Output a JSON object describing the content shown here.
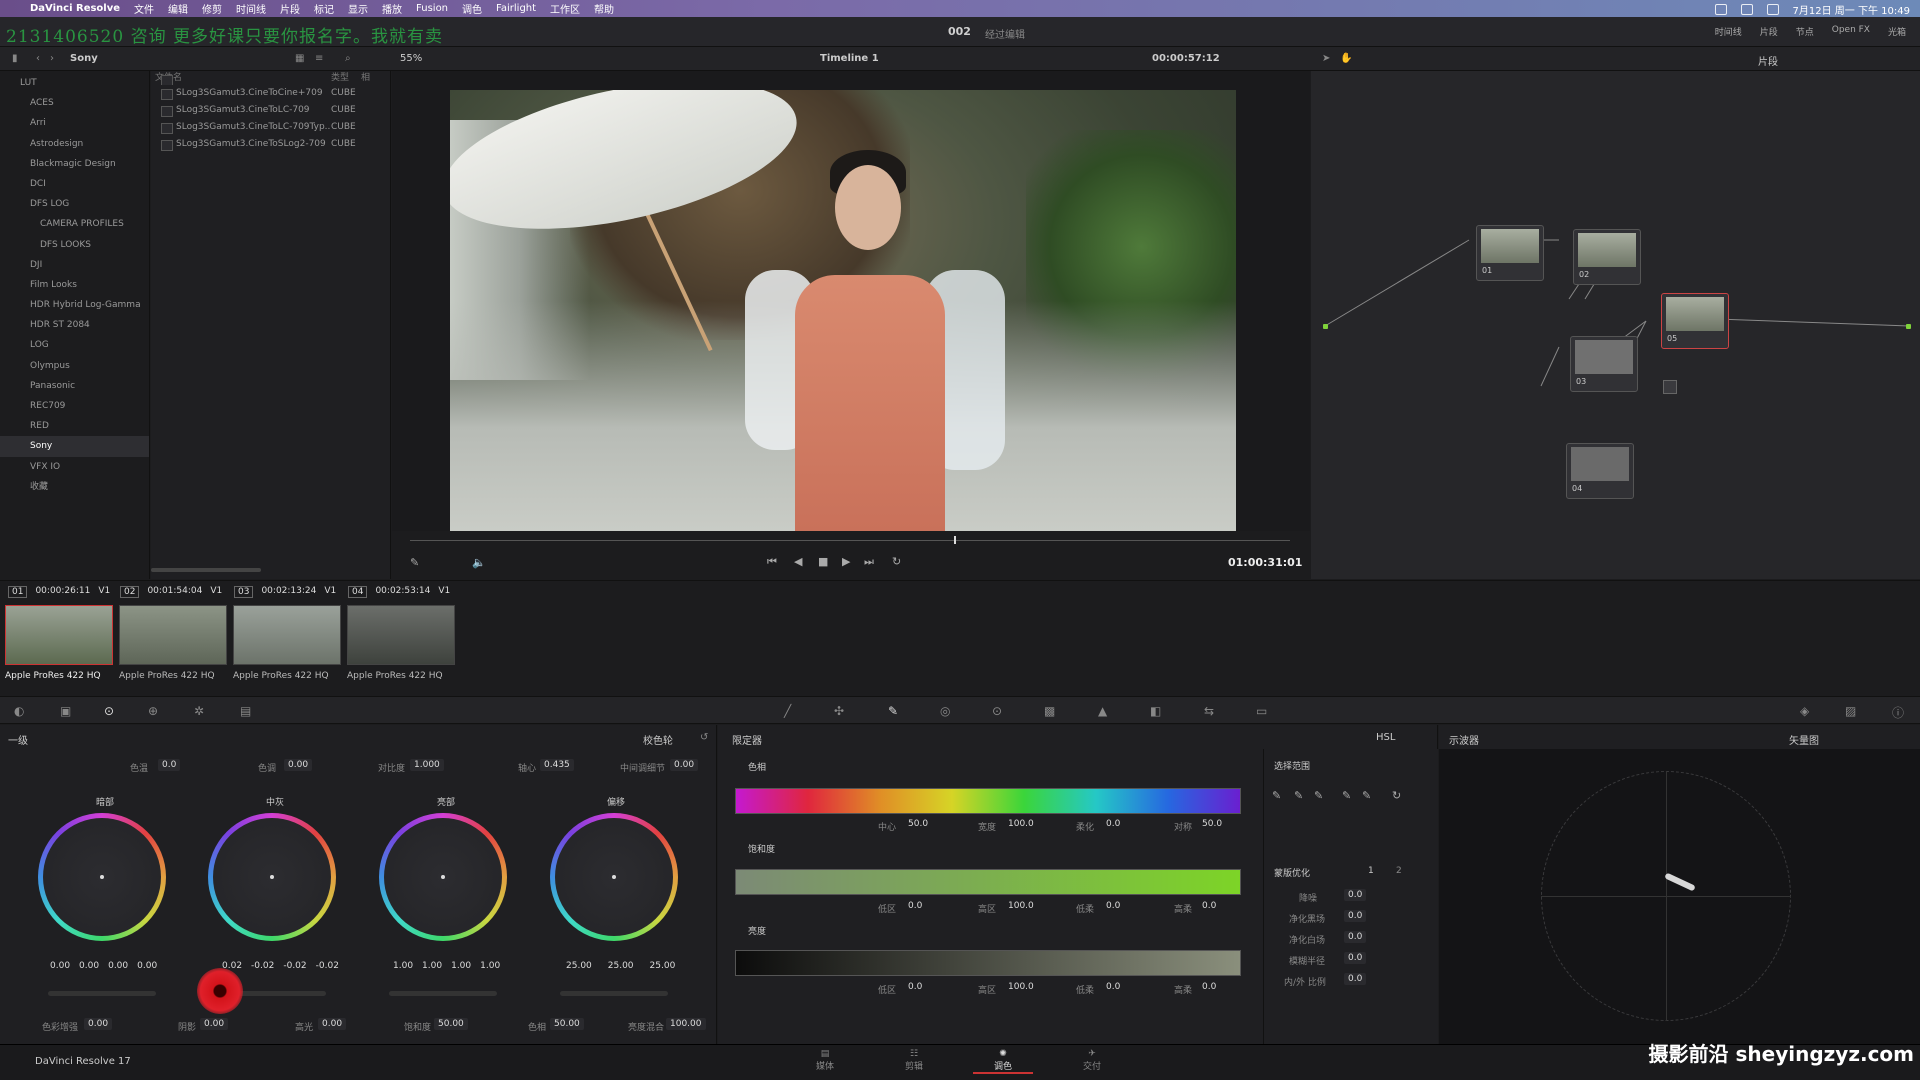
{
  "menubar": {
    "app": "DaVinci Resolve",
    "items": [
      "文件",
      "编辑",
      "修剪",
      "时间线",
      "片段",
      "标记",
      "显示",
      "播放",
      "Fusion",
      "调色",
      "Fairlight",
      "工作区",
      "帮助"
    ],
    "clock": "7月12日 周一 下午 10:49"
  },
  "header": {
    "project": "002",
    "status": "经过编辑",
    "overlay": "2131406520 咨询  更多好课只要你报名字。我就有卖",
    "right_items": [
      "时间线",
      "片段",
      "节点",
      "Open FX",
      "光箱"
    ]
  },
  "toolbar": {
    "folder": "Sony",
    "zoom": "55%",
    "timeline": "Timeline 1",
    "timecode": "00:00:57:12",
    "nodes_label": "片段"
  },
  "lut_tree": {
    "root": "LUT",
    "items": [
      "ACES",
      "Arri",
      "Astrodesign",
      "Blackmagic Design",
      "DCI",
      "DFS LOG",
      "CAMERA PROFILES",
      "DFS LOOKS",
      "DJI",
      "Film Looks",
      "HDR Hybrid Log-Gamma",
      "HDR ST 2084",
      "LOG",
      "Olympus",
      "Panasonic",
      "REC709",
      "RED",
      "Sony",
      "VFX IO",
      "收藏"
    ],
    "selected": "Sony"
  },
  "lut_files": {
    "headers": [
      "文件名",
      "类型",
      "相"
    ],
    "rows": [
      {
        "name": "SLog3SGamut3.CineToCine+709",
        "type": "CUBE"
      },
      {
        "name": "SLog3SGamut3.CineToLC-709",
        "type": "CUBE"
      },
      {
        "name": "SLog3SGamut3.CineToLC-709Typ...",
        "type": "CUBE"
      },
      {
        "name": "SLog3SGamut3.CineToSLog2-709",
        "type": "CUBE"
      }
    ]
  },
  "viewer": {
    "playhead_tc": "01:00:31:01"
  },
  "nodes": [
    {
      "label": "01"
    },
    {
      "label": "02"
    },
    {
      "label": "03"
    },
    {
      "label": "04"
    },
    {
      "label": "05"
    }
  ],
  "clips": [
    {
      "num": "01",
      "tc": "00:00:26:11",
      "track": "V1",
      "codec": "Apple ProRes 422 HQ"
    },
    {
      "num": "02",
      "tc": "00:01:54:04",
      "track": "V1",
      "codec": "Apple ProRes 422 HQ"
    },
    {
      "num": "03",
      "tc": "00:02:13:24",
      "track": "V1",
      "codec": "Apple ProRes 422 HQ"
    },
    {
      "num": "04",
      "tc": "00:02:53:14",
      "track": "V1",
      "codec": "Apple ProRes 422 HQ"
    }
  ],
  "primaries": {
    "title": "一级",
    "mode": "校色轮",
    "top": [
      {
        "label": "色温",
        "value": "0.0"
      },
      {
        "label": "色调",
        "value": "0.00"
      },
      {
        "label": "对比度",
        "value": "1.000"
      },
      {
        "label": "轴心",
        "value": "0.435"
      },
      {
        "label": "中间调细节",
        "value": "0.00"
      }
    ],
    "wheels": [
      {
        "title": "暗部",
        "values": [
          "0.00",
          "0.00",
          "0.00",
          "0.00"
        ]
      },
      {
        "title": "中灰",
        "values": [
          "0.02",
          "-0.02",
          "-0.02",
          "-0.02"
        ]
      },
      {
        "title": "亮部",
        "values": [
          "1.00",
          "1.00",
          "1.00",
          "1.00"
        ]
      },
      {
        "title": "偏移",
        "values": [
          "25.00",
          "25.00",
          "25.00"
        ]
      }
    ],
    "bottom": [
      {
        "label": "色彩增强",
        "value": "0.00"
      },
      {
        "label": "阴影",
        "value": "0.00"
      },
      {
        "label": "高光",
        "value": "0.00"
      },
      {
        "label": "饱和度",
        "value": "50.00"
      },
      {
        "label": "色相",
        "value": "50.00"
      },
      {
        "label": "亮度混合",
        "value": "100.00"
      }
    ]
  },
  "qualifier": {
    "title": "限定器",
    "mode": "HSL",
    "hue": {
      "title": "色相",
      "params": [
        [
          "中心",
          "50.0"
        ],
        [
          "宽度",
          "100.0"
        ],
        [
          "柔化",
          "0.0"
        ],
        [
          "对称",
          "50.0"
        ]
      ]
    },
    "sat": {
      "title": "饱和度",
      "params": [
        [
          "低区",
          "0.0"
        ],
        [
          "高区",
          "100.0"
        ],
        [
          "低柔",
          "0.0"
        ],
        [
          "高柔",
          "0.0"
        ]
      ]
    },
    "lum": {
      "title": "亮度",
      "params": [
        [
          "低区",
          "0.0"
        ],
        [
          "高区",
          "100.0"
        ],
        [
          "低柔",
          "0.0"
        ],
        [
          "高柔",
          "0.0"
        ]
      ]
    },
    "select_range": "选择范围",
    "matte": "蒙版优化",
    "tabs": [
      "1",
      "2"
    ],
    "matte_params": [
      [
        "降噪",
        "0.0"
      ],
      [
        "净化黑场",
        "0.0"
      ],
      [
        "净化白场",
        "0.0"
      ],
      [
        "模糊半径",
        "0.0"
      ],
      [
        "内/外 比例",
        "0.0"
      ]
    ]
  },
  "scope": {
    "title": "示波器",
    "mode": "矢量图"
  },
  "bottomnav": {
    "version": "DaVinci Resolve 17",
    "tabs": [
      "媒体",
      "剪辑",
      "调色",
      "交付"
    ],
    "selected": "调色"
  },
  "watermark": "摄影前沿 sheyingzyz.com"
}
